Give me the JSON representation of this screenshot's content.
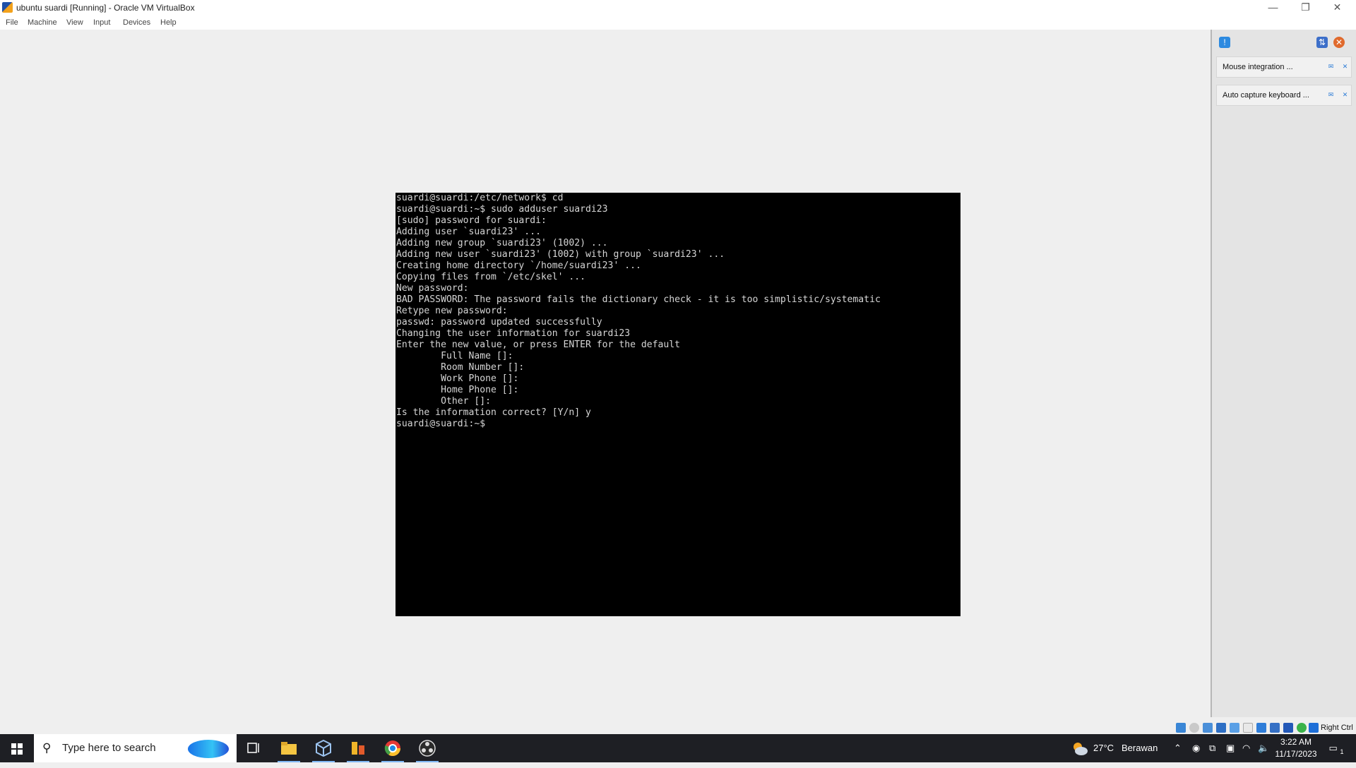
{
  "window": {
    "title": "ubuntu suardi [Running] - Oracle VM VirtualBox",
    "controls": {
      "minimize": "—",
      "restore": "❐",
      "close": "✕"
    }
  },
  "menu": [
    "File",
    "Machine",
    "View",
    "Input",
    "Devices",
    "Help"
  ],
  "terminal": {
    "lines": [
      "suardi@suardi:/etc/network$ cd",
      "suardi@suardi:~$ sudo adduser suardi23",
      "[sudo] password for suardi:",
      "Adding user `suardi23' ...",
      "Adding new group `suardi23' (1002) ...",
      "Adding new user `suardi23' (1002) with group `suardi23' ...",
      "Creating home directory `/home/suardi23' ...",
      "Copying files from `/etc/skel' ...",
      "New password:",
      "BAD PASSWORD: The password fails the dictionary check - it is too simplistic/systematic",
      "Retype new password:",
      "passwd: password updated successfully",
      "Changing the user information for suardi23",
      "Enter the new value, or press ENTER for the default",
      "        Full Name []:",
      "        Room Number []:",
      "        Work Phone []:",
      "        Home Phone []:",
      "        Other []:",
      "Is the information correct? [Y/n] y",
      "suardi@suardi:~$"
    ]
  },
  "notifications": [
    {
      "text": "Mouse integration ..."
    },
    {
      "text": "Auto capture keyboard ..."
    }
  ],
  "statusbar": {
    "host_key": "Right Ctrl"
  },
  "taskbar": {
    "search_placeholder": "Type here to search",
    "weather": {
      "temp": "27°C",
      "condition": "Berawan"
    },
    "time": "3:22 AM",
    "date": "11/17/2023",
    "notification_count": "1"
  }
}
